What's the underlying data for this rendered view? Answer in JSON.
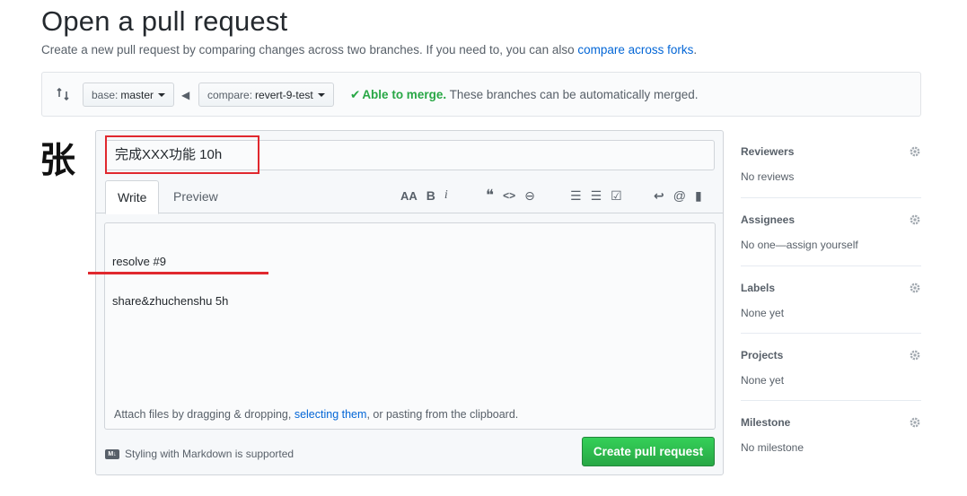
{
  "page": {
    "title": "Open a pull request",
    "subtitle_text": "Create a new pull request by comparing changes across two branches. If you need to, you can also ",
    "subtitle_link": "compare across forks",
    "subtitle_end": "."
  },
  "range": {
    "base_prefix": "base:",
    "base_value": "master",
    "compare_prefix": "compare:",
    "compare_value": "revert-9-test",
    "merge_ok": "Able to merge.",
    "merge_msg": " These branches can be automatically merged."
  },
  "annotation": {
    "calligraphy_char": "张"
  },
  "editor": {
    "title_value": "完成XXX功能 10h",
    "tab_write": "Write",
    "tab_preview": "Preview",
    "body_line1": "resolve #9",
    "body_line2": "share&zhuchenshu 5h",
    "attach_prefix": "Attach files by dragging & dropping, ",
    "attach_link": "selecting them",
    "attach_suffix": ", or pasting from the clipboard.",
    "markdown_note": "Styling with Markdown is supported",
    "markdown_icon": "M↓",
    "submit_label": "Create pull request"
  },
  "toolbar": {
    "header": "AA",
    "bold": "B",
    "italic": "i",
    "quote": "❝",
    "code": "<>",
    "link": "⊖",
    "ul": "☰",
    "ol": "☰",
    "task": "☑",
    "reply": "↩",
    "mention": "@",
    "bookmark": "▮"
  },
  "sidebar": {
    "sections": [
      {
        "label": "Reviewers",
        "value": "No reviews"
      },
      {
        "label": "Assignees",
        "value": "No one—assign yourself"
      },
      {
        "label": "Labels",
        "value": "None yet"
      },
      {
        "label": "Projects",
        "value": "None yet"
      },
      {
        "label": "Milestone",
        "value": "No milestone"
      }
    ]
  },
  "colors": {
    "accent_link": "#0366d6",
    "success": "#28a745",
    "annotation_red": "#e0282e"
  }
}
